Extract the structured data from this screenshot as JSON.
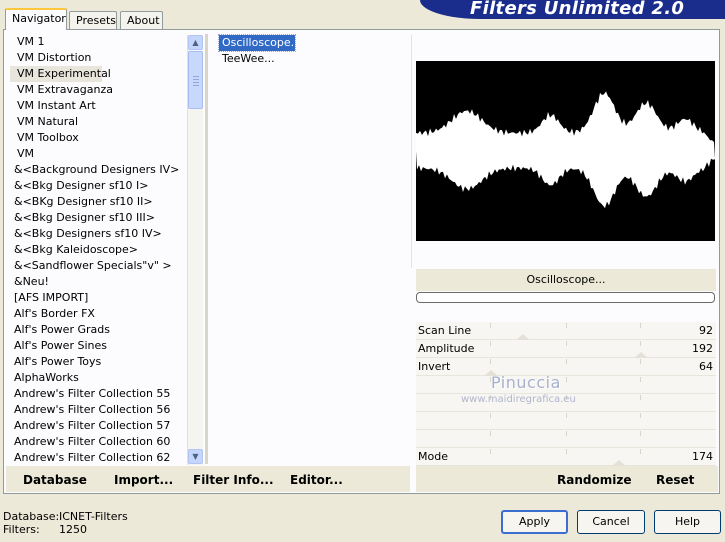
{
  "tabs": [
    {
      "label": "Navigator"
    },
    {
      "label": "Presets"
    },
    {
      "label": "About"
    }
  ],
  "banner": {
    "title": "Filters Unlimited 2.0"
  },
  "categories": [
    {
      "label": "VM 1"
    },
    {
      "label": "VM Distortion"
    },
    {
      "label": "VM Experimental"
    },
    {
      "label": "VM Extravaganza"
    },
    {
      "label": "VM Instant Art"
    },
    {
      "label": "VM Natural"
    },
    {
      "label": "VM Toolbox"
    },
    {
      "label": "VM"
    },
    {
      "label": "&<Background Designers IV>"
    },
    {
      "label": "&<Bkg Designer sf10 I>"
    },
    {
      "label": "&<BKg Designer sf10 II>"
    },
    {
      "label": "&<Bkg Designer sf10 III>"
    },
    {
      "label": "&<Bkg Designers sf10 IV>"
    },
    {
      "label": "&<Bkg Kaleidoscope>"
    },
    {
      "label": "&<Sandflower Specials\"v\" >"
    },
    {
      "label": "&Neu!"
    },
    {
      "label": "[AFS IMPORT]"
    },
    {
      "label": "Alf's Border FX"
    },
    {
      "label": "Alf's Power Grads"
    },
    {
      "label": "Alf's Power Sines"
    },
    {
      "label": "Alf's Power Toys"
    },
    {
      "label": "AlphaWorks"
    },
    {
      "label": "Andrew's Filter Collection 55"
    },
    {
      "label": "Andrew's Filter Collection 56"
    },
    {
      "label": "Andrew's Filter Collection 57"
    },
    {
      "label": "Andrew's Filter Collection 60"
    },
    {
      "label": "Andrew's Filter Collection 62"
    }
  ],
  "selected_category": "VM Experimental",
  "filters": [
    {
      "label": "Oscilloscope..."
    },
    {
      "label": "TeeWee..."
    }
  ],
  "selected_filter": "Oscilloscope...",
  "preview": {
    "filter_name": "Oscilloscope..."
  },
  "params": [
    {
      "label": "Scan Line",
      "value": "92"
    },
    {
      "label": "Amplitude",
      "value": "192"
    },
    {
      "label": "Invert",
      "value": "64"
    },
    {
      "label": "",
      "value": ""
    },
    {
      "label": "",
      "value": ""
    },
    {
      "label": "",
      "value": ""
    },
    {
      "label": "",
      "value": ""
    },
    {
      "label": "Mode",
      "value": "174"
    }
  ],
  "watermark": {
    "name": "Pinuccia",
    "site": "www.maidiregrafica.eu"
  },
  "toolbar_left": {
    "database": "Database",
    "import": "Import...",
    "filter_info": "Filter Info...",
    "editor": "Editor..."
  },
  "toolbar_right": {
    "randomize": "Randomize",
    "reset": "Reset"
  },
  "footer": {
    "database_label": "Database:",
    "database_value": "ICNET-Filters",
    "filters_label": "Filters:",
    "filters_value": "1250"
  },
  "buttons": {
    "apply": "Apply",
    "cancel": "Cancel",
    "help": "Help"
  },
  "colors": {
    "window_bg": "#ece9d8",
    "banner_bg": "#1a2d8c",
    "selection": "#316ac5"
  }
}
